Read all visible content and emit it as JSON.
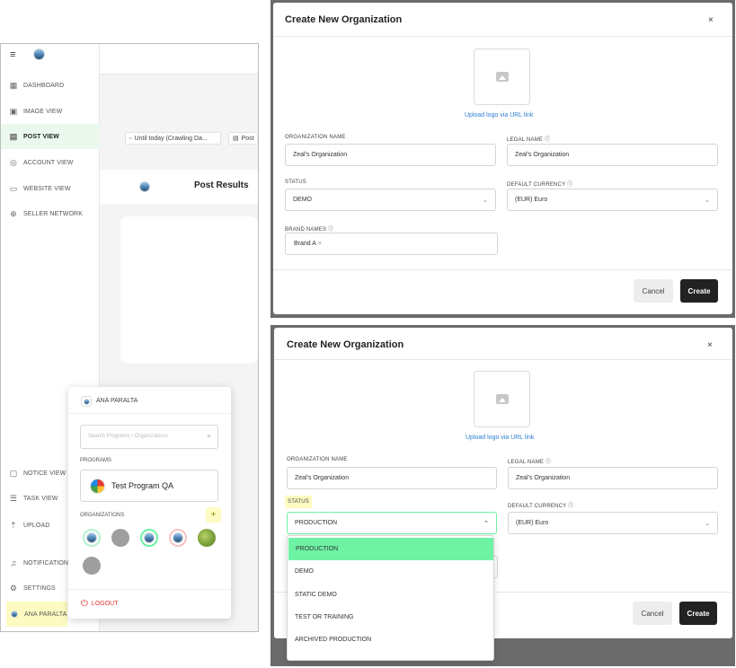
{
  "sidebar": {
    "items": [
      {
        "label": "DASHBOARD",
        "icon": "dashboard-icon"
      },
      {
        "label": "IMAGE VIEW",
        "icon": "image-icon"
      },
      {
        "label": "POST VIEW",
        "icon": "post-icon",
        "active": true
      },
      {
        "label": "ACCOUNT VIEW",
        "icon": "account-icon"
      },
      {
        "label": "WEBSITE VIEW",
        "icon": "website-icon"
      },
      {
        "label": "SELLER NETWORK",
        "icon": "network-icon"
      }
    ],
    "bottom_items": [
      {
        "label": "NOTICE VIEW",
        "icon": "notice-icon"
      },
      {
        "label": "TASK VIEW",
        "icon": "task-icon"
      },
      {
        "label": "UPLOAD",
        "icon": "upload-icon"
      },
      {
        "label": "NOTIFICATION",
        "icon": "bell-icon"
      },
      {
        "label": "SETTINGS",
        "icon": "gear-icon"
      },
      {
        "label": "ANA PARALTA",
        "icon": "user-logo-icon"
      }
    ]
  },
  "main": {
    "filter_1": "Until today (Crawling Da...",
    "filter_2": "Post",
    "post_results_title": "Post Results"
  },
  "popup": {
    "user_name": "ANA PARALTA",
    "search_placeholder": "Search Programs / Organizations",
    "programs_label": "PROGRAMS",
    "program_name": "Test Program QA",
    "organizations_label": "ORGANIZATIONS",
    "add_label": "+",
    "logout_label": "LOGOUT"
  },
  "modal1": {
    "title": "Create New Organization",
    "close": "×",
    "upload_link": "Upload logo via URL link",
    "org_name_label": "ORGANIZATION NAME",
    "org_name_value": "Zeal's Organization",
    "legal_name_label": "LEGAL NAME",
    "legal_name_value": "Zeal's Organization",
    "status_label": "STATUS",
    "status_value": "DEMO",
    "currency_label": "DEFAULT CURRENCY",
    "currency_value": "(EUR) Euro",
    "brand_names_label": "BRAND NAMES",
    "brand_chip": "Brand A",
    "brand_chip_remove": "×",
    "cancel": "Cancel",
    "create": "Create"
  },
  "modal2": {
    "title": "Create New Organization",
    "close": "×",
    "upload_link": "Upload logo via URL link",
    "org_name_label": "ORGANIZATION NAME",
    "org_name_value": "Zeal's Organization",
    "legal_name_label": "LEGAL NAME",
    "legal_name_value": "Zeal's Organization",
    "status_label": "STATUS",
    "status_value": "PRODUCTION",
    "currency_label": "DEFAULT CURRENCY",
    "currency_value": "(EUR) Euro",
    "cancel": "Cancel",
    "create": "Create",
    "status_options": [
      "PRODUCTION",
      "DEMO",
      "STATIC DEMO",
      "TEST OR TRAINING",
      "ARCHIVED PRODUCTION"
    ]
  },
  "colors": {
    "accent_green": "#6ef2a4",
    "highlight_yellow": "#fdfbc2",
    "link_blue": "#2f80d1",
    "logout_red": "#e0342b"
  }
}
